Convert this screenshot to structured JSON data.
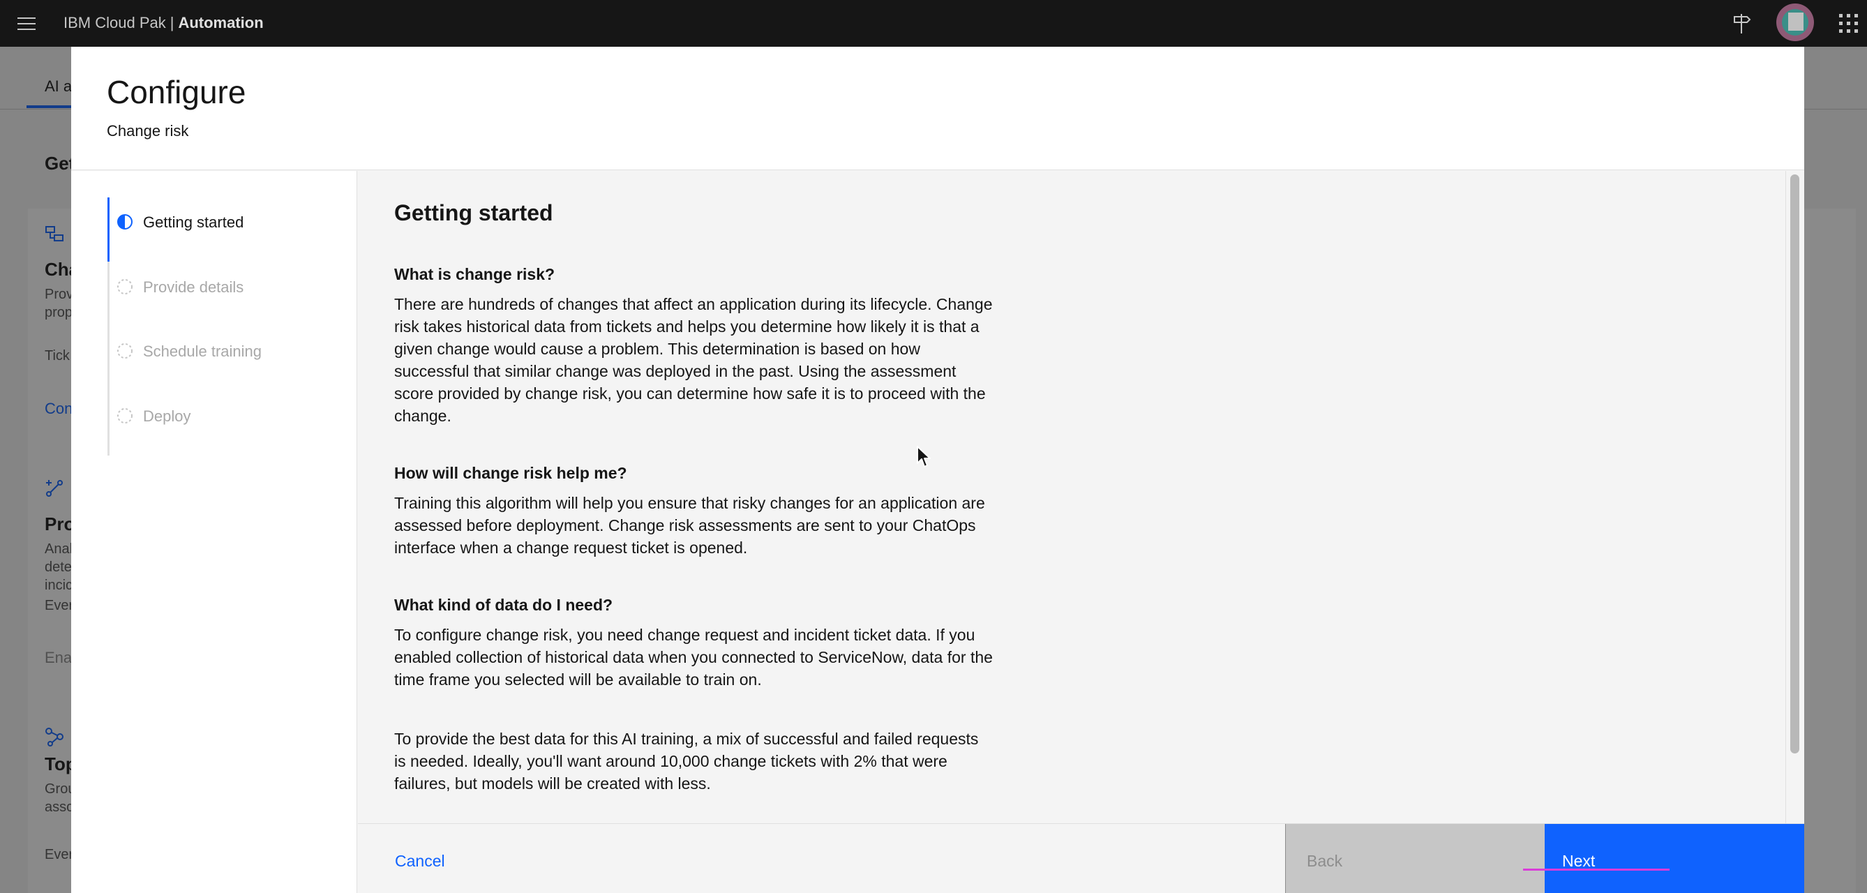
{
  "shell": {
    "brand_prefix": "IBM Cloud Pak",
    "separator": "|",
    "brand_product": "Automation",
    "icons": [
      "menu-icon",
      "waypoint-icon",
      "user-avatar",
      "app-switcher-icon"
    ]
  },
  "background": {
    "tab_label": "AI a",
    "heading": "Get",
    "cards": [
      {
        "title": "Cha",
        "desc_1": "Prov",
        "desc_2": "prop",
        "meta": "Tick",
        "link": "Con"
      },
      {
        "title": "Pro",
        "desc_1": "Anal",
        "desc_2": "dete",
        "desc_3": "incic",
        "meta": "Ever",
        "link": "Ena"
      },
      {
        "title": "Top",
        "desc_1": "Grou",
        "desc_2": "assc",
        "meta": "Ever"
      }
    ]
  },
  "modal": {
    "title": "Configure",
    "subtitle": "Change risk",
    "steps": [
      {
        "label": "Getting started",
        "state": "current"
      },
      {
        "label": "Provide details",
        "state": "incomplete"
      },
      {
        "label": "Schedule training",
        "state": "incomplete"
      },
      {
        "label": "Deploy",
        "state": "incomplete"
      }
    ],
    "content": {
      "title": "Getting started",
      "sections": [
        {
          "heading": "What is change risk?",
          "body": "There are hundreds of changes that affect an application during its lifecycle. Change risk takes historical data from tickets and helps you determine how likely it is that a given change would cause a problem. This determination is based on how successful that similar change was deployed in the past. Using the assessment score provided by change risk, you can determine how safe it is to proceed with the change."
        },
        {
          "heading": "How will change risk help me?",
          "body": "Training this algorithm will help you ensure that risky changes for an application are assessed before deployment. Change risk assessments are sent to your ChatOps interface when a change request ticket is opened."
        },
        {
          "heading": "What kind of data do I need?",
          "body": "To configure change risk, you need change request and incident ticket data. If you enabled collection of historical data when you connected to ServiceNow, data for the time frame you selected will be available to train on."
        },
        {
          "heading": "",
          "body": "To provide the best data for this AI training, a mix of successful and failed requests is needed. Ideally, you'll want around 10,000 change tickets with 2% that were failures, but models will be created with less."
        }
      ]
    },
    "footer": {
      "cancel": "Cancel",
      "back": "Back",
      "next": "Next"
    }
  },
  "colors": {
    "shell_bg": "#161616",
    "accent": "#0f62fe",
    "disabled_btn": "#c6c6c6",
    "annotation_line": "#d93dd9"
  }
}
